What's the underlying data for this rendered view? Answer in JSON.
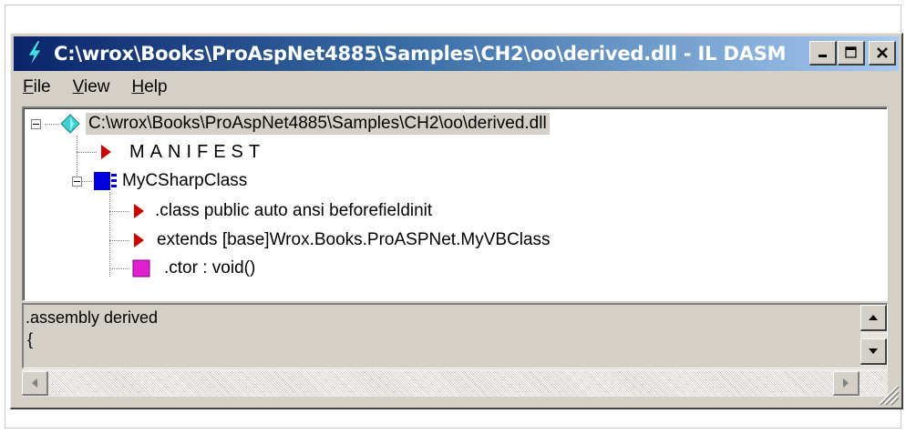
{
  "window": {
    "title": "C:\\wrox\\Books\\ProAspNet4885\\Samples\\CH2\\oo\\derived.dll - IL DASM",
    "buttons": [
      "minimize",
      "maximize",
      "close"
    ]
  },
  "menu": {
    "file": {
      "accel": "F",
      "rest": "ile"
    },
    "view": {
      "accel": "V",
      "rest": "iew"
    },
    "help": {
      "accel": "H",
      "rest": "elp"
    }
  },
  "tree": {
    "root": {
      "label": "C:\\wrox\\Books\\ProAspNet4885\\Samples\\CH2\\oo\\derived.dll",
      "icon": "assembly-diamond-icon"
    },
    "manifest": {
      "label": "MANIFEST",
      "icon": "red-triangle-icon"
    },
    "class": {
      "label": "MyCSharpClass",
      "icon": "class-icon"
    },
    "members": [
      {
        "label": ".class public auto ansi beforefieldinit",
        "icon": "red-triangle-icon"
      },
      {
        "label": "extends [base]Wrox.Books.ProASPNet.MyVBClass",
        "icon": "red-triangle-icon"
      },
      {
        "label": ".ctor : void()",
        "icon": "method-icon"
      }
    ]
  },
  "info": {
    "line1": ".assembly derived",
    "line2": "{"
  },
  "colors": {
    "title_gradient_start": "#0a246a",
    "title_gradient_end": "#a6caf0",
    "face": "#d4d0c8",
    "triangle": "#cc0000",
    "class_icon": "#0000cc",
    "method_icon": "#e020d0",
    "diamond": "#40d0d0"
  }
}
